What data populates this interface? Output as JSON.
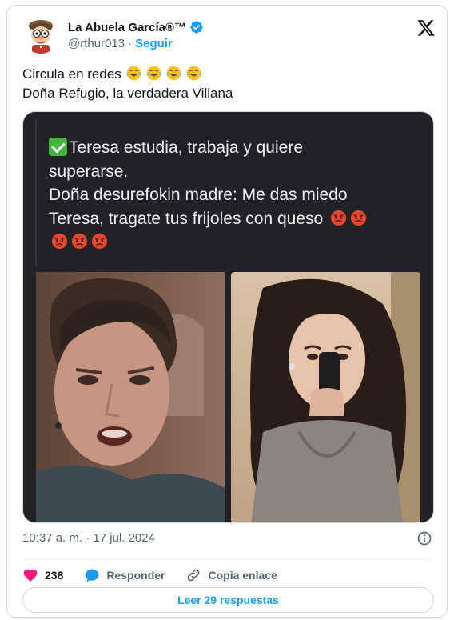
{
  "author": {
    "display_name": "La Abuela García®™",
    "handle": "@rthur013",
    "separator": "·",
    "follow_label": "Seguir"
  },
  "tweet": {
    "lines": [
      "Circula en redes",
      "Doña Refugio, la verdadera Villana"
    ],
    "line1_emoji": "tears-of-joy-emoji ×4"
  },
  "media": {
    "meme_lines": [
      "Teresa estudia, trabaja y quiere",
      "superarse.",
      "Doña desurefokin madre:  Me das miedo",
      "Teresa, tragate tus frijoles con queso"
    ],
    "check_emoji": "check-mark-emoji",
    "angry_emoji": "angry-face-emoji"
  },
  "meta": {
    "timestamp": "10:37 a. m. · 17 jul. 2024"
  },
  "actions": {
    "likes_count": "238",
    "reply_label": "Responder",
    "copy_link_label": "Copia enlace"
  },
  "read_replies_label": "Leer 29 respuestas",
  "colors": {
    "accent": "#1d9bf0",
    "like": "#f91880",
    "text": "#0f1419",
    "secondary": "#536471"
  }
}
